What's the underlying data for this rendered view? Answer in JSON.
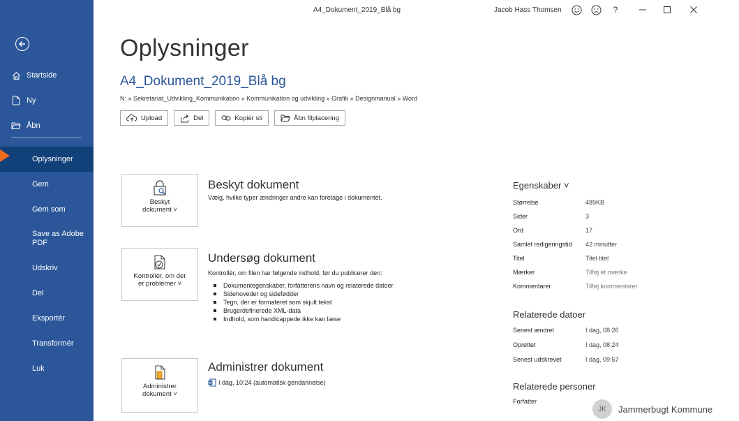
{
  "window": {
    "doc_title": "A4_Dokument_2019_Blå bg",
    "user": "Jacob Hass Thomsen",
    "help": "?"
  },
  "sidebar": {
    "top_items": [
      {
        "label": "Startside",
        "icon": "home-icon"
      },
      {
        "label": "Ny",
        "icon": "new-document-icon"
      },
      {
        "label": "Åbn",
        "icon": "folder-open-icon"
      }
    ],
    "items": [
      {
        "label": "Oplysninger",
        "active": true
      },
      {
        "label": "Gem"
      },
      {
        "label": "Gem som"
      },
      {
        "label": "Save as Adobe PDF"
      },
      {
        "label": "Udskriv"
      },
      {
        "label": "Del"
      },
      {
        "label": "Eksportér"
      },
      {
        "label": "Transformér"
      },
      {
        "label": "Luk"
      }
    ]
  },
  "main": {
    "heading": "Oplysninger",
    "file_name": "A4_Dokument_2019_Blå bg",
    "path": "N: » Sekretariat_Udvikling_Kommunikation » Kommunikation og udvikling » Grafik » Designmanual » Word",
    "buttons": {
      "upload": "Upload",
      "share": "Del",
      "copy_path": "Kopiér sti",
      "open_location": "Åbn filplacering"
    },
    "protect": {
      "tile_label_1": "Beskyt",
      "tile_label_2": "dokument ˅",
      "title": "Beskyt dokument",
      "desc": "Vælg, hvilke typer ændringer andre kan foretage i dokumentet."
    },
    "inspect": {
      "tile_label_1": "Kontrollér, om der",
      "tile_label_2": "er problemer ˅",
      "title": "Undersøg dokument",
      "desc": "Kontrollér, om filen har følgende indhold, før du publicerer den:",
      "bullets": [
        "Dokumentegenskaber, forfatterens navn og relaterede datoer",
        "Sidehoveder og sidefødder",
        "Tegn, der er formateret som skjult tekst",
        "Brugerdefinerede XML-data",
        "Indhold, som handicappede ikke kan læse"
      ]
    },
    "manage": {
      "tile_label_1": "Administrer",
      "tile_label_2": "dokument ˅",
      "title": "Administrer dokument",
      "version": "I dag, 10:24 (automatisk gendannelse)"
    }
  },
  "properties": {
    "heading": "Egenskaber ˅",
    "rows": [
      {
        "key": "Størrelse",
        "value": "489KB"
      },
      {
        "key": "Sider",
        "value": "3"
      },
      {
        "key": "Ord",
        "value": "17"
      },
      {
        "key": "Samlet redigeringstid",
        "value": "42 minutter"
      },
      {
        "key": "Titel",
        "value": "Titel titel"
      },
      {
        "key": "Mærker",
        "value": "Tilføj et mærke"
      },
      {
        "key": "Kommentarer",
        "value": "Tilføj kommentarer"
      }
    ],
    "dates_heading": "Relaterede datoer",
    "dates": [
      {
        "key": "Senest ændret",
        "value": "I dag, 08:26"
      },
      {
        "key": "Oprettet",
        "value": "I dag, 08:24"
      },
      {
        "key": "Senest udskrevet",
        "value": "I dag, 09:57"
      }
    ],
    "people_heading": "Relaterede personer",
    "author_label": "Forfatter",
    "author_initials": "JK",
    "author_name": "Jammerbugt Kommune"
  }
}
